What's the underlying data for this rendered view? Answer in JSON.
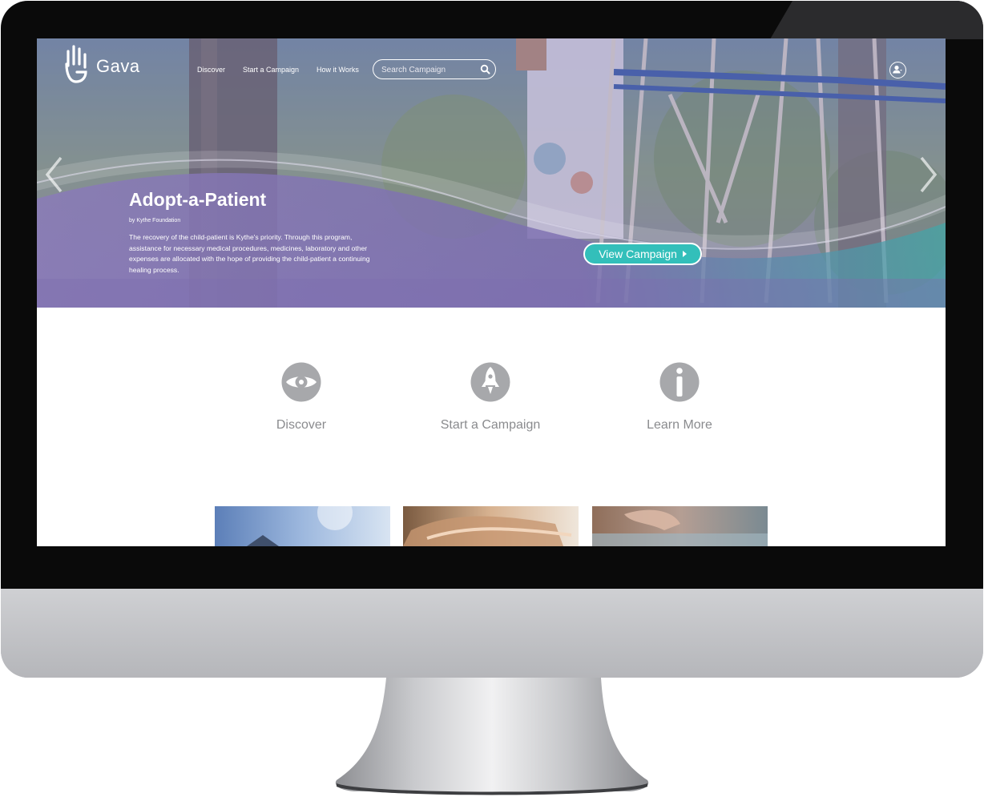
{
  "brand": {
    "name": "Gava"
  },
  "nav": {
    "links": [
      "Discover",
      "Start a Campaign",
      "How it Works"
    ],
    "search_placeholder": "Search Campaign"
  },
  "hero": {
    "title": "Adopt-a-Patient",
    "byline": "by Kythe Foundation",
    "description": "The recovery of the child-patient is Kythe's priority. Through this program, assistance for necessary medical procedures, medicines, laboratory and other expenses are allocated with the hope of providing the child-patient a continuing healing process.",
    "cta_label": "View Campaign"
  },
  "features": [
    {
      "label": "Discover",
      "icon": "eye-icon"
    },
    {
      "label": "Start a Campaign",
      "icon": "rocket-icon"
    },
    {
      "label": "Learn More",
      "icon": "info-icon"
    }
  ],
  "colors": {
    "accent": "#33bfba",
    "hero_overlay": "#7d6fb0",
    "feature_icon": "#a7a8ab",
    "feature_text": "#8a8b8e"
  }
}
